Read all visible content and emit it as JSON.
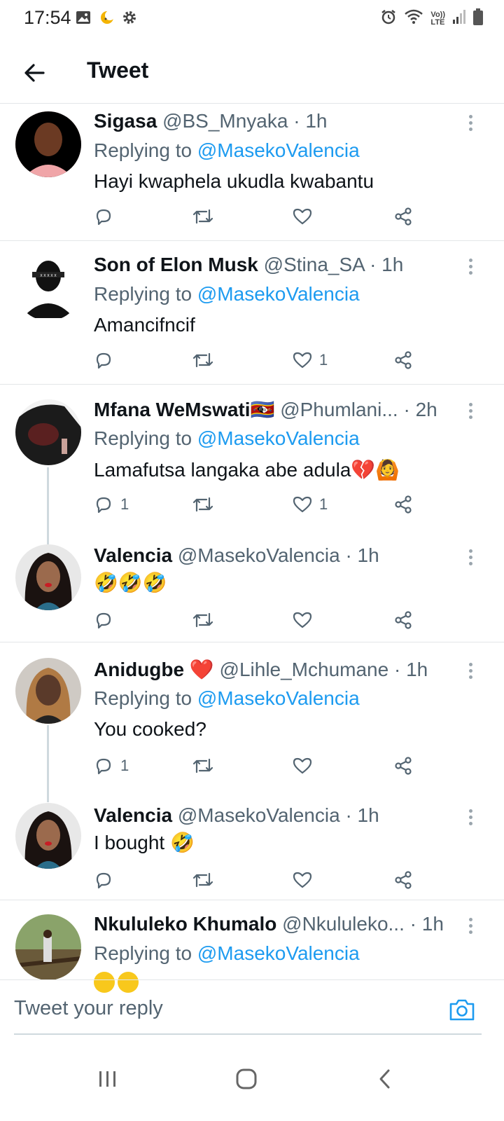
{
  "status_bar": {
    "time": "17:54",
    "left_icons": [
      "gallery-icon",
      "night-mode-icon",
      "settings-gear-icon"
    ],
    "right_icons": [
      "alarm-icon",
      "wifi-icon",
      "volte-icon",
      "signal-icon",
      "battery-icon"
    ],
    "volte_top": "Vo))",
    "volte_bottom": "LTE"
  },
  "header": {
    "title": "Tweet"
  },
  "colors": {
    "accent": "#1d9bf0",
    "text": "#0f1419",
    "muted": "#536471",
    "divider": "#e3e6e8"
  },
  "tweets": [
    {
      "name": "Sigasa",
      "handle": "@BS_Mnyaka",
      "time": "· 1h",
      "replying_prefix": "Replying to ",
      "replying_to": "@MasekoValencia",
      "text": "Hayi kwaphela ukudla kwabantu",
      "reply_count": "",
      "like_count": ""
    },
    {
      "name": "Son of Elon Musk",
      "handle": "@Stina_SA",
      "time": "· 1h",
      "replying_prefix": "Replying to ",
      "replying_to": "@MasekoValencia",
      "text": "Amancifncif",
      "reply_count": "",
      "like_count": "1"
    },
    {
      "name": "Mfana WeMswati",
      "name_emoji": "🇸🇿",
      "handle": "@Phumlani...",
      "time": "· 2h",
      "replying_prefix": "Replying to ",
      "replying_to": "@MasekoValencia",
      "text": "Lamafutsa langaka abe adula",
      "text_emoji": "💔🙆",
      "reply_count": "1",
      "like_count": "1"
    },
    {
      "name": "Valencia",
      "handle": "@MasekoValencia",
      "time": "· 1h",
      "text": "🤣🤣🤣",
      "reply_count": "",
      "like_count": ""
    },
    {
      "name": "Anidugbe",
      "name_emoji": "❤️",
      "handle": "@Lihle_Mchumane",
      "time": "· 1h",
      "replying_prefix": "Replying to ",
      "replying_to": "@MasekoValencia",
      "text": "You cooked?",
      "reply_count": "1",
      "like_count": ""
    },
    {
      "name": "Valencia",
      "handle": "@MasekoValencia",
      "time": "· 1h",
      "text": "I bought",
      "text_emoji": "🤣",
      "reply_count": "",
      "like_count": ""
    },
    {
      "name": "Nkululeko Khumalo",
      "handle": "@Nkululeko...",
      "time": "· 1h",
      "replying_prefix": "Replying to ",
      "replying_to": "@MasekoValencia"
    }
  ],
  "compose": {
    "placeholder": "Tweet your reply"
  },
  "nav_icons": [
    "recent-apps-icon",
    "home-icon",
    "back-nav-icon"
  ]
}
